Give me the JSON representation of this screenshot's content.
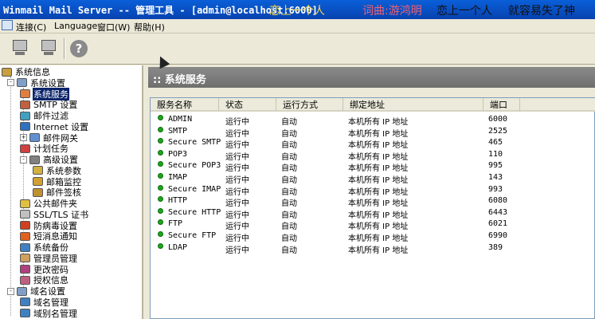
{
  "window": {
    "title": "Winmail Mail Server -- 管理工具 - [admin@localhost:6000]",
    "overlay_texts": [
      "恋上一个人",
      "词曲:游鸿明",
      "恋上一个人",
      "就容易失了神"
    ],
    "colors": {
      "titlebar": "#0a5fd8",
      "overlay_gold": "#f5d84c",
      "overlay_pink": "#f06070",
      "overlay_black": "#111111"
    }
  },
  "menu": {
    "items": [
      "连接(C)",
      "Language",
      "窗口(W)",
      "帮助(H)"
    ]
  },
  "toolbar": {
    "buttons": [
      {
        "name": "connect-icon"
      },
      {
        "name": "disconnect-icon"
      },
      {
        "name": "help-icon",
        "glyph": "?"
      }
    ]
  },
  "tree": {
    "items": [
      {
        "label": "系统信息",
        "depth": 0,
        "expander": "",
        "icon": "server-icon",
        "color": "#c8a040"
      },
      {
        "label": "系统设置",
        "depth": 1,
        "expander": "-",
        "icon": "settings-icon",
        "color": "#80a0c8"
      },
      {
        "label": "系统服务",
        "depth": 2,
        "expander": "",
        "icon": "services-icon",
        "color": "#e08040",
        "selected": true
      },
      {
        "label": "SMTP 设置",
        "depth": 2,
        "expander": "",
        "icon": "smtp-icon",
        "color": "#c06040"
      },
      {
        "label": "邮件过滤",
        "depth": 2,
        "expander": "",
        "icon": "filter-icon",
        "color": "#40a0c0"
      },
      {
        "label": "Internet 设置",
        "depth": 2,
        "expander": "",
        "icon": "globe-icon",
        "color": "#3070c0"
      },
      {
        "label": "邮件网关",
        "depth": 2,
        "expander": "+",
        "icon": "gateway-icon",
        "color": "#6090d0"
      },
      {
        "label": "计划任务",
        "depth": 2,
        "expander": "",
        "icon": "schedule-icon",
        "color": "#d04040"
      },
      {
        "label": "高级设置",
        "depth": 2,
        "expander": "-",
        "icon": "advanced-icon",
        "color": "#808080"
      },
      {
        "label": "系统参数",
        "depth": 3,
        "expander": "",
        "icon": "params-icon",
        "color": "#d0b040"
      },
      {
        "label": "邮箱监控",
        "depth": 3,
        "expander": "",
        "icon": "monitor-icon",
        "color": "#d0a030"
      },
      {
        "label": "邮件签核",
        "depth": 3,
        "expander": "",
        "icon": "approve-icon",
        "color": "#c09030"
      },
      {
        "label": "公共邮件夹",
        "depth": 2,
        "expander": "",
        "icon": "folder-icon",
        "color": "#e0c040"
      },
      {
        "label": "SSL/TLS 证书",
        "depth": 2,
        "expander": "",
        "icon": "certificate-icon",
        "color": "#c0c0c0"
      },
      {
        "label": "防病毒设置",
        "depth": 2,
        "expander": "",
        "icon": "antivirus-icon",
        "color": "#d04020"
      },
      {
        "label": "短消息通知",
        "depth": 2,
        "expander": "",
        "icon": "sms-icon",
        "color": "#e06020"
      },
      {
        "label": "系统备份",
        "depth": 2,
        "expander": "",
        "icon": "backup-icon",
        "color": "#4080c0"
      },
      {
        "label": "管理员管理",
        "depth": 2,
        "expander": "",
        "icon": "admin-icon",
        "color": "#d0a060"
      },
      {
        "label": "更改密码",
        "depth": 2,
        "expander": "",
        "icon": "password-icon",
        "color": "#b04080"
      },
      {
        "label": "授权信息",
        "depth": 2,
        "expander": "",
        "icon": "license-icon",
        "color": "#c06080"
      },
      {
        "label": "域名设置",
        "depth": 1,
        "expander": "-",
        "icon": "domain-settings-icon",
        "color": "#80a0c8"
      },
      {
        "label": "域名管理",
        "depth": 2,
        "expander": "",
        "icon": "domain-icon",
        "color": "#4080c0"
      },
      {
        "label": "域别名管理",
        "depth": 2,
        "expander": "",
        "icon": "domain-alias-icon",
        "color": "#4080c0"
      }
    ]
  },
  "panel": {
    "title": ":: 系统服务"
  },
  "table": {
    "columns": [
      "服务名称",
      "状态",
      "运行方式",
      "绑定地址",
      "端口"
    ],
    "rows": [
      [
        "ADMIN",
        "运行中",
        "自动",
        "本机所有 IP 地址",
        "6000"
      ],
      [
        "SMTP",
        "运行中",
        "自动",
        "本机所有 IP 地址",
        "2525"
      ],
      [
        "Secure SMTP",
        "运行中",
        "自动",
        "本机所有 IP 地址",
        "465"
      ],
      [
        "POP3",
        "运行中",
        "自动",
        "本机所有 IP 地址",
        "110"
      ],
      [
        "Secure POP3",
        "运行中",
        "自动",
        "本机所有 IP 地址",
        "995"
      ],
      [
        "IMAP",
        "运行中",
        "自动",
        "本机所有 IP 地址",
        "143"
      ],
      [
        "Secure IMAP",
        "运行中",
        "自动",
        "本机所有 IP 地址",
        "993"
      ],
      [
        "HTTP",
        "运行中",
        "自动",
        "本机所有 IP 地址",
        "6080"
      ],
      [
        "Secure HTTP",
        "运行中",
        "自动",
        "本机所有 IP 地址",
        "6443"
      ],
      [
        "FTP",
        "运行中",
        "自动",
        "本机所有 IP 地址",
        "6021"
      ],
      [
        "Secure FTP",
        "运行中",
        "自动",
        "本机所有 IP 地址",
        "6990"
      ],
      [
        "LDAP",
        "运行中",
        "自动",
        "本机所有 IP 地址",
        "389"
      ]
    ],
    "status_color": "#1fa41f"
  }
}
